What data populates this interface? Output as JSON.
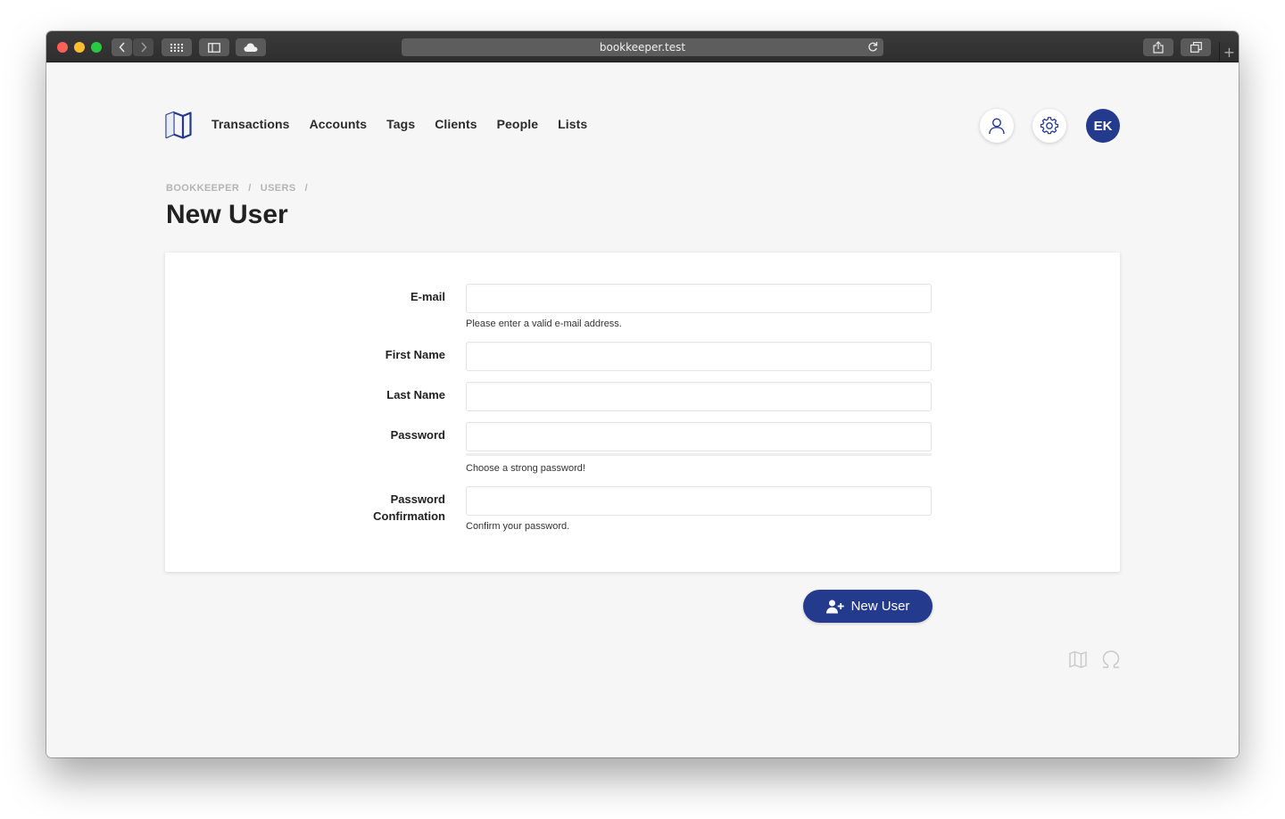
{
  "browser": {
    "url": "bookkeeper.test",
    "new_tab_symbol": "+"
  },
  "nav": {
    "items": [
      {
        "label": "Transactions"
      },
      {
        "label": "Accounts"
      },
      {
        "label": "Tags"
      },
      {
        "label": "Clients"
      },
      {
        "label": "People"
      },
      {
        "label": "Lists"
      }
    ]
  },
  "header": {
    "avatar_initials": "EK",
    "icons": [
      "map-logo-icon",
      "user-icon",
      "gear-icon"
    ]
  },
  "breadcrumb": {
    "items": [
      "BOOKKEEPER",
      "/",
      "USERS",
      "/"
    ]
  },
  "page": {
    "title": "New User"
  },
  "form": {
    "email_label": "E-mail",
    "email_value": "",
    "email_help": "Please enter a valid e-mail address.",
    "first_name_label": "First Name",
    "first_name_value": "",
    "last_name_label": "Last Name",
    "last_name_value": "",
    "password_label": "Password",
    "password_value": "",
    "password_help": "Choose a strong password!",
    "password_confirm_label_line1": "Password",
    "password_confirm_label_line2": "Confirmation",
    "password_confirm_value": "",
    "password_confirm_help": "Confirm your password.",
    "submit_label": "New User"
  },
  "footer": {
    "icons": [
      "map-icon",
      "omega-icon"
    ]
  },
  "colors": {
    "primary": "#243a8c",
    "page_bg": "#f6f6f6"
  }
}
